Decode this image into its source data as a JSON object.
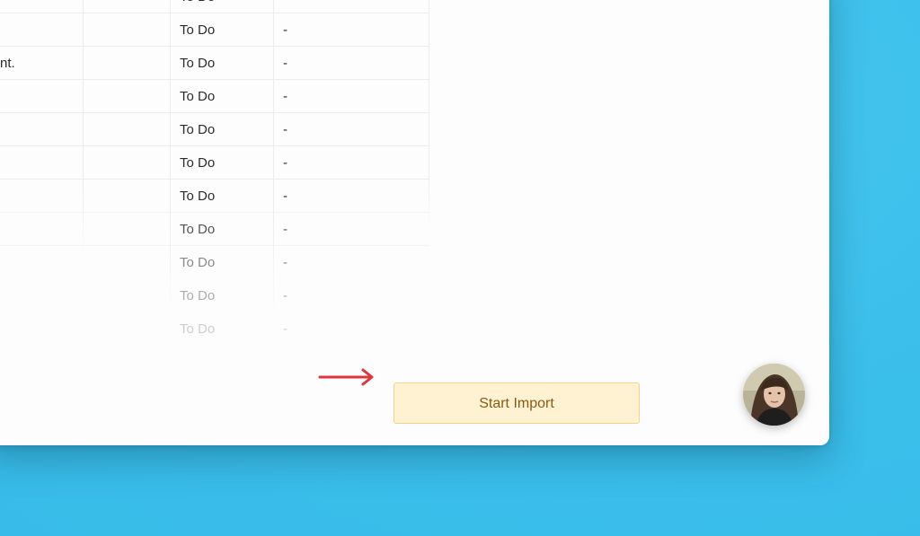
{
  "table": {
    "rows": [
      {
        "desc": "",
        "status": "To Do",
        "assignee": ""
      },
      {
        "desc": "",
        "status": "To Do",
        "assignee": "-"
      },
      {
        "desc": "nt.",
        "status": "To Do",
        "assignee": "-"
      },
      {
        "desc": "",
        "status": "To Do",
        "assignee": "-"
      },
      {
        "desc": "",
        "status": "To Do",
        "assignee": "-"
      },
      {
        "desc": "",
        "status": "To Do",
        "assignee": "-"
      },
      {
        "desc": "",
        "status": "To Do",
        "assignee": "-"
      },
      {
        "desc": "",
        "status": "To Do",
        "assignee": "-"
      },
      {
        "desc": "",
        "status": "To Do",
        "assignee": "-"
      },
      {
        "desc": "",
        "status": "To Do",
        "assignee": "-"
      },
      {
        "desc": "",
        "status": "To Do",
        "assignee": "-"
      }
    ]
  },
  "actions": {
    "start_import_label": "Start Import"
  },
  "colors": {
    "background": "#3bbfea",
    "button_bg": "#fff2d2",
    "button_border": "#f2d58a",
    "button_text": "#8a5a14",
    "arrow": "#e0333c"
  },
  "icons": {
    "arrow": "arrow-right-icon",
    "avatar": "user-avatar"
  }
}
